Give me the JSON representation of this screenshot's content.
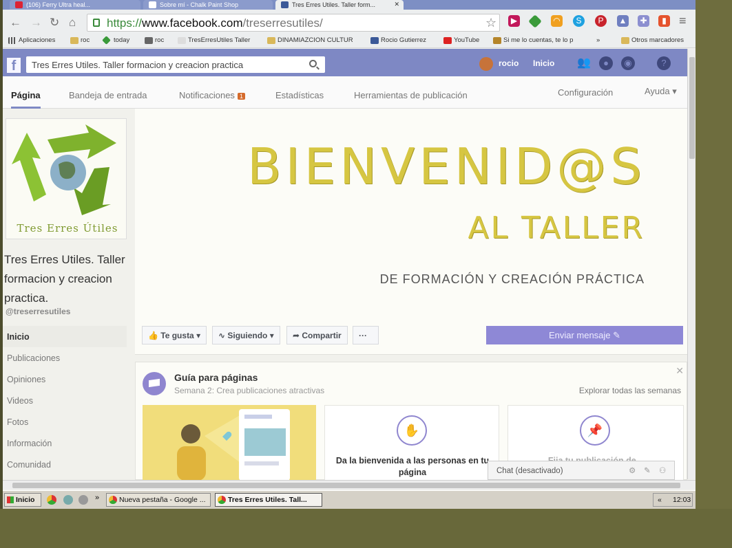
{
  "browser": {
    "tabs": [
      {
        "label": "(106) Ferry Ultra heal...",
        "active": false
      },
      {
        "label": "Sobre mí - Chalk Paint Shop",
        "active": false
      },
      {
        "label": "Tres Erres Utiles. Taller form...",
        "active": true
      }
    ],
    "url_scheme": "https://",
    "url_host": "www.facebook.com",
    "url_path": "/treserresutiles/",
    "bookmarks": [
      {
        "label": "Aplicaciones",
        "icon": "apps-grid-icon"
      },
      {
        "label": "roc",
        "icon": "folder-icon"
      },
      {
        "label": "today",
        "icon": "diamond-icon"
      },
      {
        "label": "roc",
        "icon": "page-icon"
      },
      {
        "label": "TresErresUtiles Taller",
        "icon": "star-icon"
      },
      {
        "label": "DINAMIAZCION CULTUR",
        "icon": "folder-icon"
      },
      {
        "label": "Rocio Gutierrez",
        "icon": "facebook-icon"
      },
      {
        "label": "YouTube",
        "icon": "youtube-icon"
      },
      {
        "label": "Si me lo cuentas, te lo p",
        "icon": "bookmark-icon"
      },
      {
        "label": "»",
        "icon": ""
      },
      {
        "label": "Otros marcadores",
        "icon": "folder-icon"
      }
    ]
  },
  "facebook": {
    "search_value": "Tres Erres Utiles. Taller formacion y creacion practica",
    "user_name": "rocio",
    "home_label": "Inicio"
  },
  "page_tabs": {
    "pagina": "Página",
    "inbox": "Bandeja de entrada",
    "notifications": "Notificaciones",
    "notifications_count": "1",
    "stats": "Estadísticas",
    "tools": "Herramientas de publicación",
    "settings": "Configuración",
    "help": "Ayuda ▾"
  },
  "page": {
    "logo_text": "Tres Erres Útiles",
    "name": "Tres Erres Utiles. Taller formacion y creacion practica.",
    "handle": "@treserresutiles",
    "nav": [
      "Inicio",
      "Publicaciones",
      "Opiniones",
      "Videos",
      "Fotos",
      "Información",
      "Comunidad"
    ]
  },
  "cover": {
    "line1": "BIENVENID@S",
    "line2": "AL TALLER",
    "line3": "DE FORMACIÓN Y CREACIÓN PRÁCTICA"
  },
  "actions": {
    "like": "Te gusta ▾",
    "following": "Siguiendo ▾",
    "share": "Compartir",
    "more": "···",
    "message": "Enviar mensaje ✎"
  },
  "guide": {
    "title": "Guía para páginas",
    "subtitle": "Semana 2: Crea publicaciones atractivas",
    "link": "Explorar todas las semanas",
    "card1_text": "Da la bienvenida a las personas en tu página",
    "card2_text": "Fija tu publicación de..."
  },
  "chat": {
    "label": "Chat (desactivado)"
  },
  "taskbar": {
    "start": "Inicio",
    "items": [
      "Nueva pestaña - Google ...",
      "Tres Erres Utiles. Tall..."
    ],
    "clock": "12:03"
  },
  "colors": {
    "facebook_blue": "#7e88c4",
    "cover_gold": "#d6c642",
    "message_button": "#8e88d6"
  }
}
